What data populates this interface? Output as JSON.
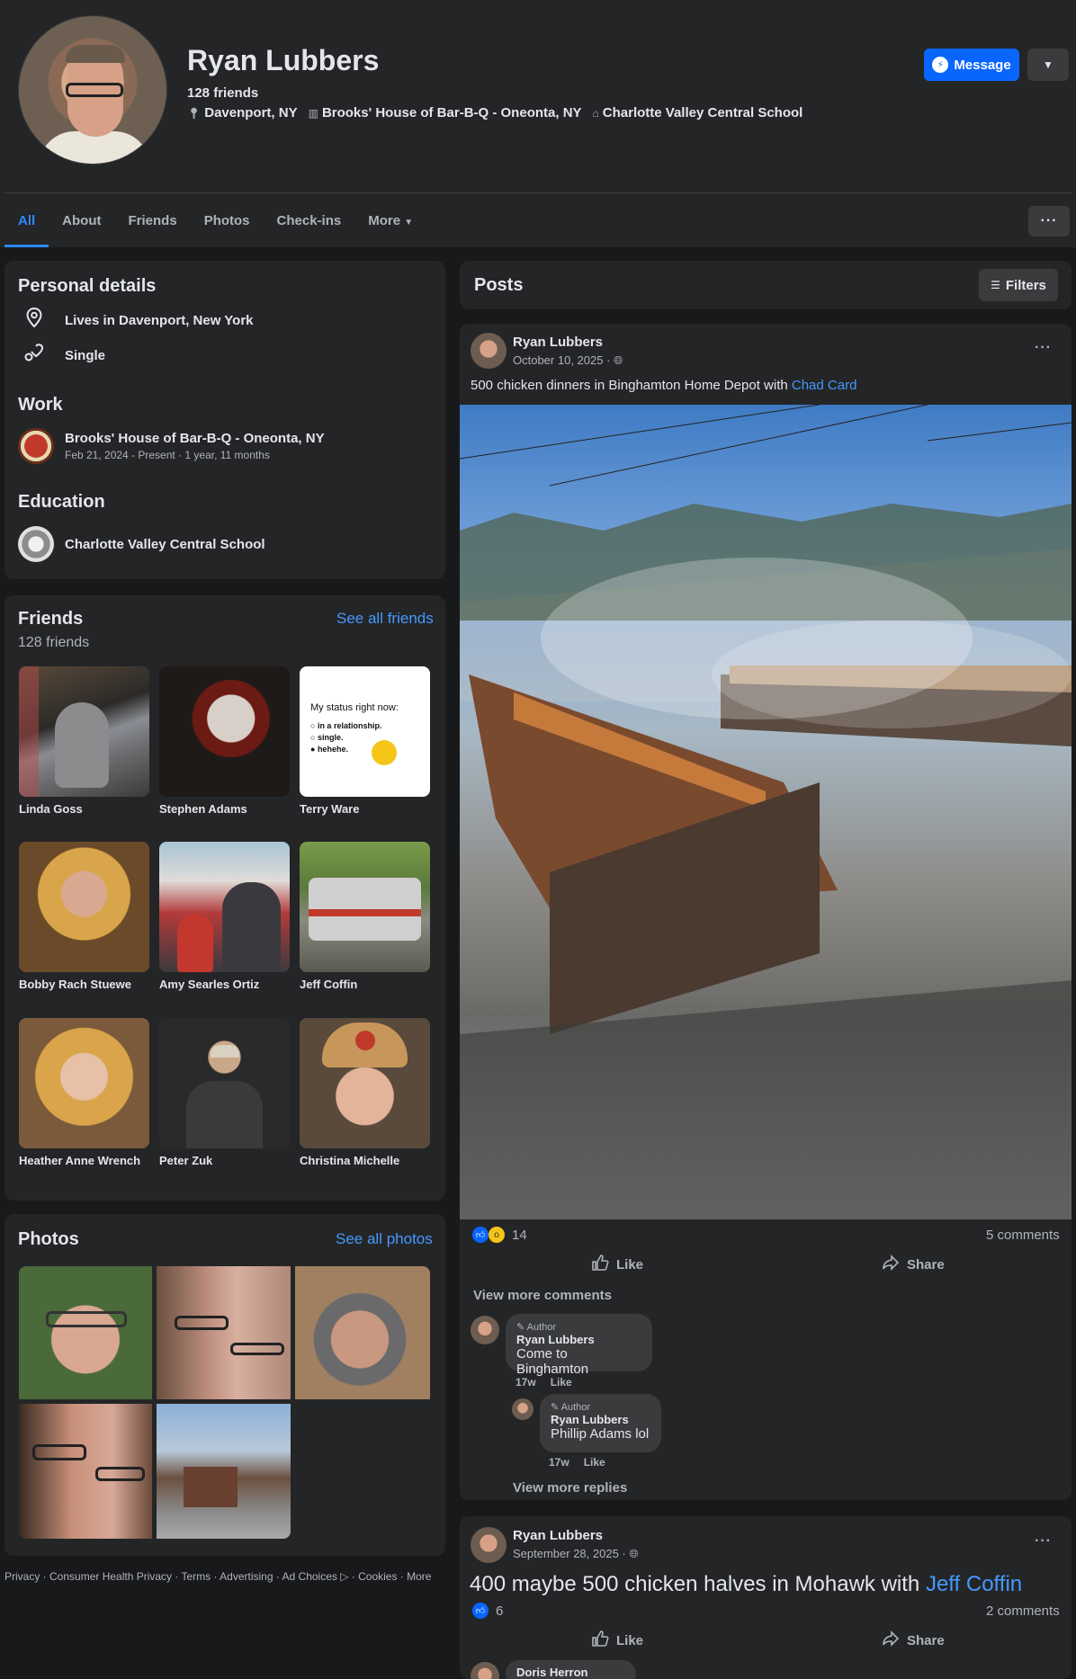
{
  "profile": {
    "name": "Ryan Lubbers",
    "friends_count": "128 friends",
    "location": "Davenport, NY",
    "work": "Brooks' House of Bar-B-Q - Oneonta, NY",
    "school": "Charlotte Valley Central School",
    "message_label": "Message"
  },
  "tabs": [
    {
      "label": "All",
      "active": true
    },
    {
      "label": "About"
    },
    {
      "label": "Friends"
    },
    {
      "label": "Photos"
    },
    {
      "label": "Check-ins"
    },
    {
      "label": "More"
    }
  ],
  "personal": {
    "title": "Personal details",
    "lives_in": "Lives in Davenport, New York",
    "relationship": "Single",
    "work_title": "Work",
    "work_place": "Brooks' House of Bar-B-Q - Oneonta, NY",
    "work_dates": "Feb 21, 2024 - Present · 1 year, 11 months",
    "education_title": "Education",
    "school": "Charlotte Valley Central School"
  },
  "friends": {
    "title": "Friends",
    "count": "128 friends",
    "see_all": "See all friends",
    "list": [
      {
        "name": "Linda Goss"
      },
      {
        "name": "Stephen Adams"
      },
      {
        "name": "Terry Ware"
      },
      {
        "name": "Bobby Rach Stuewe"
      },
      {
        "name": "Amy Searles Ortiz"
      },
      {
        "name": "Jeff Coffin"
      },
      {
        "name": "Heather Anne Wrench"
      },
      {
        "name": "Peter Zuk"
      },
      {
        "name": "Christina Michelle"
      }
    ],
    "status_meme": {
      "heading": "My status right now:",
      "opt1": "in a relationship.",
      "opt2": "single.",
      "opt3": "hehehe."
    }
  },
  "photos": {
    "title": "Photos",
    "see_all": "See all photos"
  },
  "footer": "Privacy · Consumer Health Privacy · Terms · Advertising · Ad Choices ▷ · Cookies · More",
  "posts_header": {
    "title": "Posts",
    "filters": "Filters"
  },
  "post1": {
    "author": "Ryan Lubbers",
    "date": "October 10, 2025 ·",
    "text": "500 chicken dinners in Binghamton Home Depot with ",
    "tag": "Chad Card",
    "reactions": "14",
    "comments": "5 comments",
    "like": "Like",
    "share": "Share",
    "view_more_comments": "View more comments",
    "comment1": {
      "tag": "Author",
      "name": "Ryan Lubbers",
      "text": "Come to Binghamton",
      "time": "17w",
      "like": "Like"
    },
    "reply1": {
      "tag": "Author",
      "name": "Ryan Lubbers",
      "text": "Phillip Adams lol",
      "time": "17w",
      "like": "Like"
    },
    "view_more_replies": "View more replies"
  },
  "post2": {
    "author": "Ryan Lubbers",
    "date": "September 28, 2025 ·",
    "text": "400 maybe 500 chicken halves in Mohawk with ",
    "tag": "Jeff Coffin",
    "reactions": "6",
    "comments": "2 comments",
    "like": "Like",
    "share": "Share",
    "commenter": "Doris Herron"
  },
  "colors": {
    "accent": "#0866ff",
    "link": "#4599ff",
    "card": "#242526",
    "background": "#18191a"
  }
}
